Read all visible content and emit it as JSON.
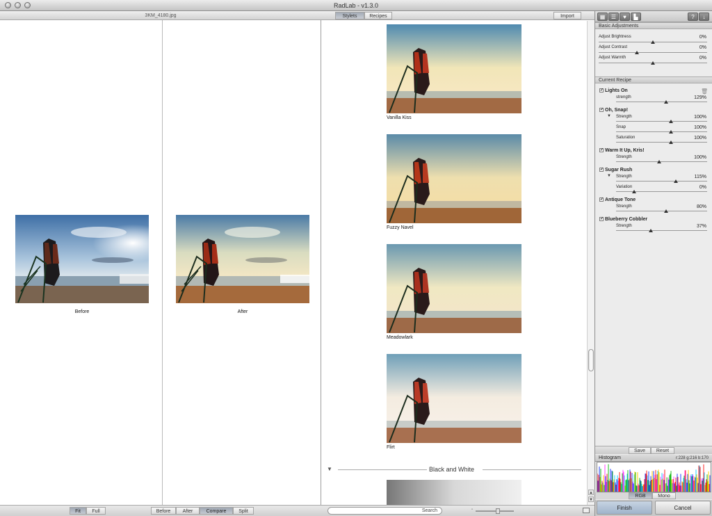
{
  "window": {
    "title": "RadLab - v1.3.0"
  },
  "left": {
    "filename": "3KM_4180.jpg",
    "before_caption": "Before",
    "after_caption": "After",
    "view_buttons": [
      "Fit",
      "Full"
    ],
    "compare_buttons": [
      "Before",
      "After",
      "Compare",
      "Split"
    ],
    "active_view": "Fit",
    "active_compare": "Compare"
  },
  "middle": {
    "tabs": [
      "Stylets",
      "Recipes"
    ],
    "active_tab": "Stylets",
    "import_label": "Import",
    "styles": [
      "Vanilla Kiss",
      "Fuzzy Navel",
      "Meadowlark",
      "Flirt"
    ],
    "section_label": "Black and White",
    "search_placeholder": "Search"
  },
  "right": {
    "toolbar_icons": [
      "grid-icon",
      "sliders-icon",
      "heart-icon",
      "chart-icon",
      "help-icon",
      "download-icon"
    ],
    "basic": {
      "title": "Basic Adjustments",
      "items": [
        {
          "label": "Adjust Brightness",
          "value": "0%",
          "level": 0.5
        },
        {
          "label": "Adjust Contrast",
          "value": "0%",
          "level": 0.35
        },
        {
          "label": "Adjust Warmth",
          "value": "0%",
          "level": 0.5
        }
      ]
    },
    "recipe": {
      "title": "Current Recipe",
      "stylets": [
        {
          "name": "Lights On",
          "sliders": [
            {
              "label": "strength",
              "value": "129%",
              "level": 0.55
            }
          ]
        },
        {
          "name": "Oh, Snap!",
          "sliders": [
            {
              "label": "Strength",
              "value": "100%",
              "level": 0.6
            },
            {
              "label": "Snap",
              "value": "100%",
              "level": 0.6
            },
            {
              "label": "Saturation",
              "value": "100%",
              "level": 0.6
            }
          ]
        },
        {
          "name": "Warm It Up, Kris!",
          "sliders": [
            {
              "label": "Strength",
              "value": "100%",
              "level": 0.47
            }
          ]
        },
        {
          "name": "Sugar Rush",
          "sliders": [
            {
              "label": "Strength",
              "value": "115%",
              "level": 0.66
            },
            {
              "label": "Variation",
              "value": "0%",
              "level": 0.2
            }
          ]
        },
        {
          "name": "Antique Tone",
          "sliders": [
            {
              "label": "Strength",
              "value": "80%",
              "level": 0.55
            }
          ]
        },
        {
          "name": "Blueberry Cobbler",
          "sliders": [
            {
              "label": "Strength",
              "value": "37%",
              "level": 0.38
            }
          ]
        }
      ]
    },
    "save_label": "Save",
    "reset_label": "Reset",
    "histogram": {
      "title": "Histogram",
      "readout": "r:228 g:216 b:170",
      "modes": [
        "RGB",
        "Mono"
      ],
      "active_mode": "RGB"
    },
    "finish_label": "Finish",
    "cancel_label": "Cancel"
  }
}
